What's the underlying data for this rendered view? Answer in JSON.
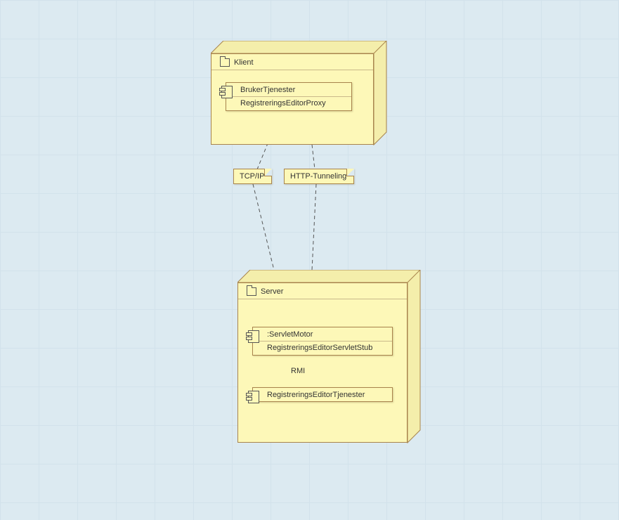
{
  "client": {
    "title": "Klient",
    "component": {
      "name": "BrukerTjenester",
      "item": "RegistreringsEditorProxy"
    }
  },
  "notes": {
    "tcp": "TCP/IP",
    "http": "HTTP-Tunneling"
  },
  "link_label": "RMI",
  "server": {
    "title": "Server",
    "servletMotor": {
      "name": ":ServletMotor",
      "item": "RegistreringsEditorServletStub"
    },
    "tjenester": {
      "name": "RegistreringsEditorTjenester"
    }
  }
}
